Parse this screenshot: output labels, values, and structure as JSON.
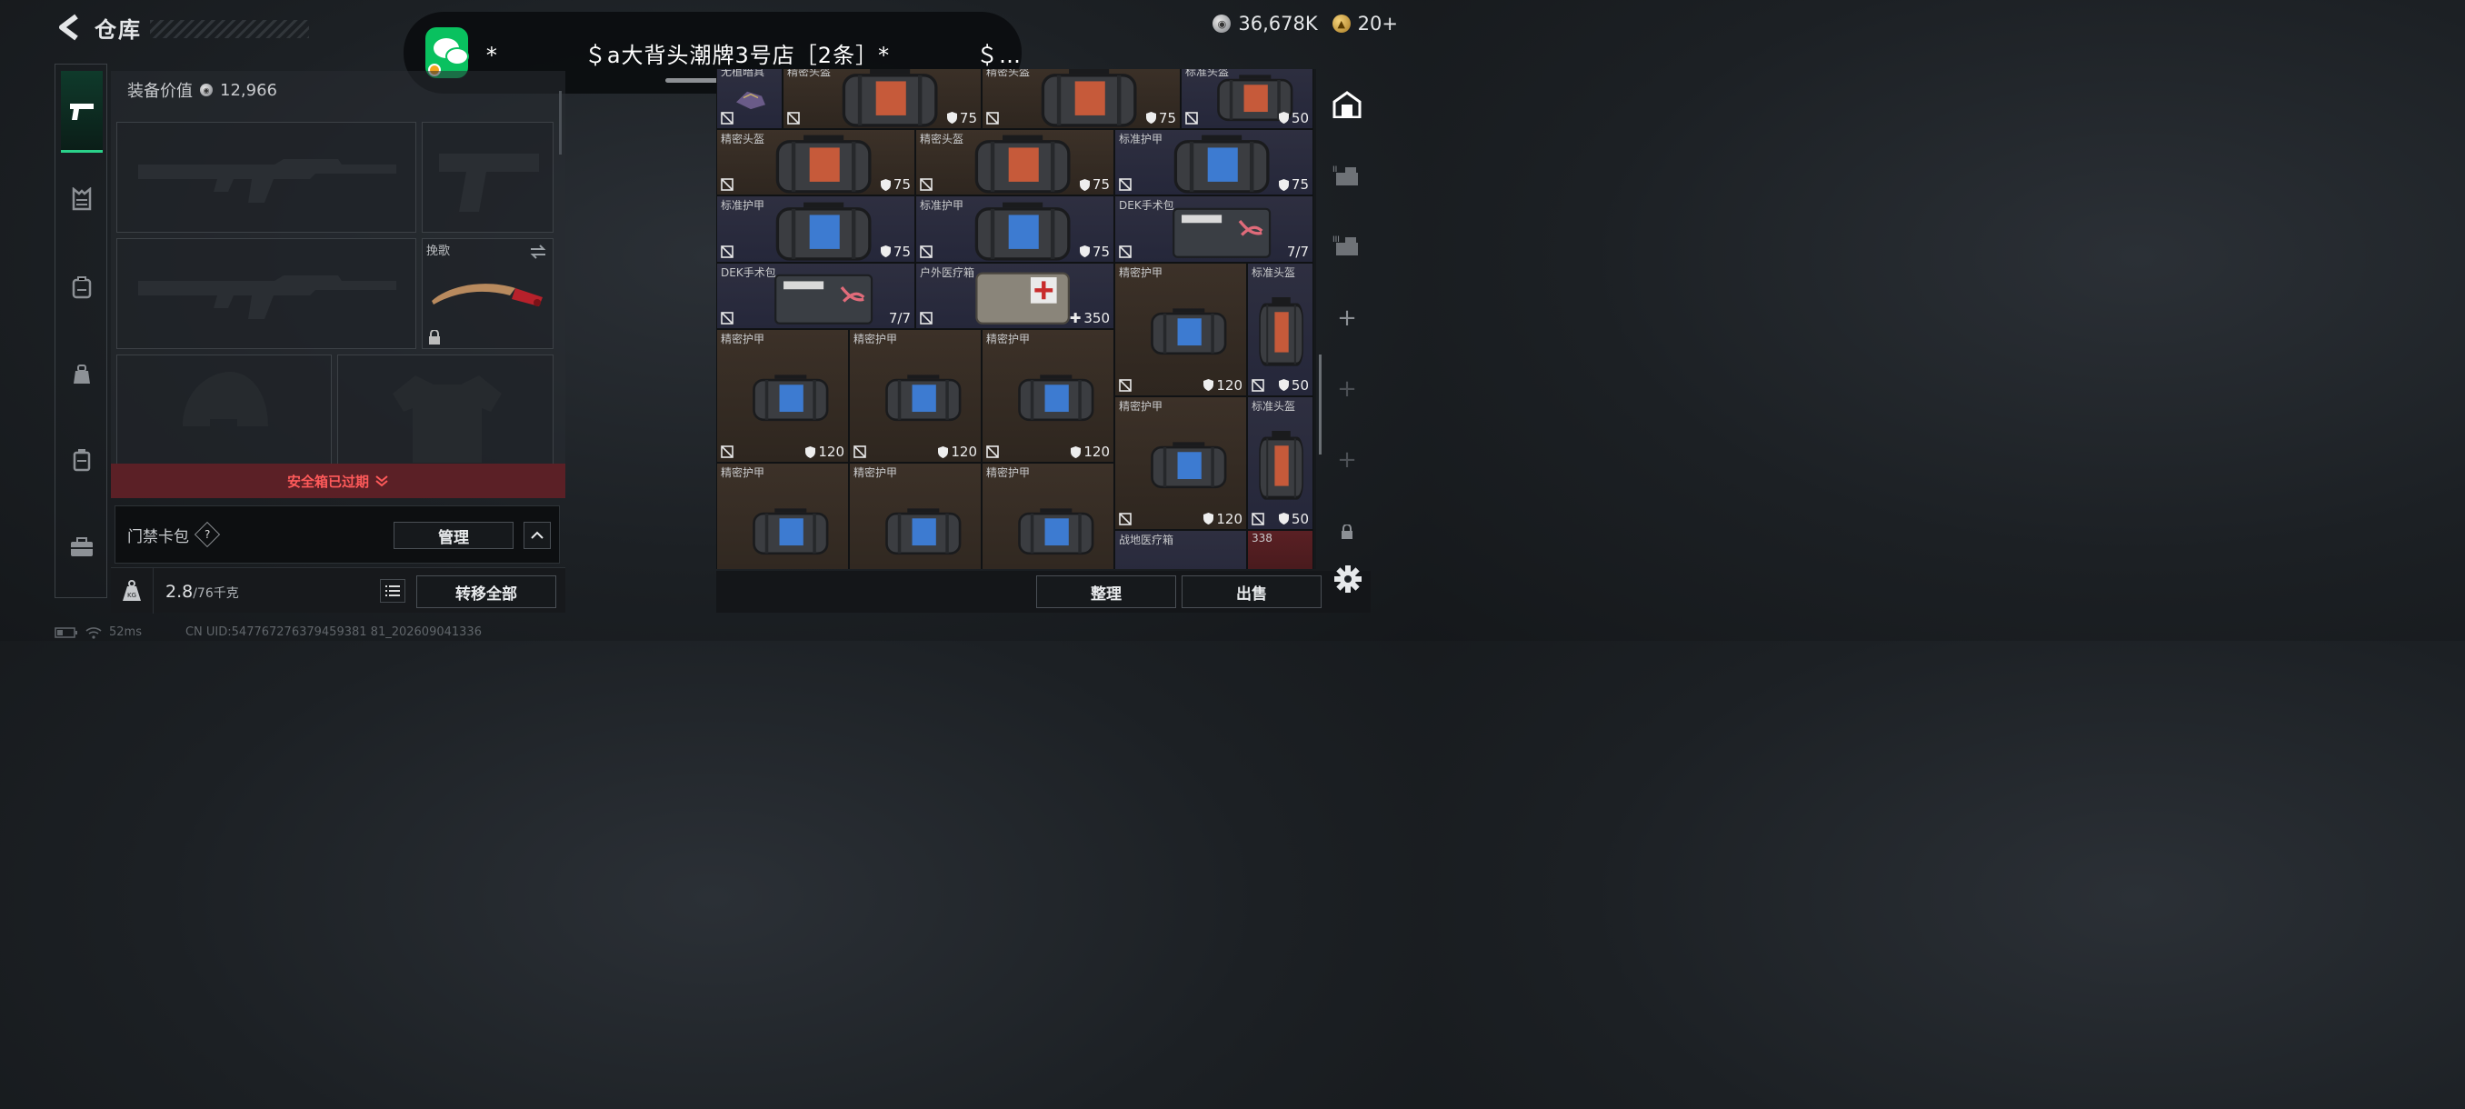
{
  "header": {
    "title": "仓库",
    "currency_silver": "36,678K",
    "currency_gold": "20+"
  },
  "notification": {
    "text": "*           ＄a大背头潮牌3号店［2条］*           ＄…"
  },
  "equipment": {
    "value_label": "装备价值",
    "value": "12,966",
    "melee_label": "挽歌"
  },
  "safe_box": {
    "status": "安全箱已过期"
  },
  "card_pack": {
    "label": "门禁卡包",
    "help": "?",
    "manage_label": "管理"
  },
  "weight": {
    "current": "2.8",
    "max": "/76千克"
  },
  "transfer_all_label": "转移全部",
  "status": {
    "ping": "52ms",
    "uid": "CN UID:547767276379459381 81_202609041336"
  },
  "warehouse": {
    "sort_label": "整理",
    "sell_label": "出售",
    "items": [
      {
        "name": "无植暗具",
        "stat": "",
        "bg": "blue"
      },
      {
        "name": "精密头盔",
        "stat": "75",
        "bg": "brown"
      },
      {
        "name": "精密头盔",
        "stat": "75",
        "bg": "brown"
      },
      {
        "name": "标准头盔",
        "stat": "50",
        "bg": "blue"
      },
      {
        "name": "精密头盔",
        "stat": "75",
        "bg": "brown"
      },
      {
        "name": "精密头盔",
        "stat": "75",
        "bg": "brown"
      },
      {
        "name": "标准护甲",
        "stat": "75",
        "bg": "blue"
      },
      {
        "name": "标准护甲",
        "stat": "75",
        "bg": "blue"
      },
      {
        "name": "标准护甲",
        "stat": "75",
        "bg": "blue"
      },
      {
        "name": "DEK手术包",
        "stat": "7/7",
        "bg": "blue"
      },
      {
        "name": "DEK手术包",
        "stat": "7/7",
        "bg": "blue"
      },
      {
        "name": "户外医疗箱",
        "stat": "350",
        "bg": "blue"
      },
      {
        "name": "精密护甲",
        "stat": "120",
        "bg": "brown"
      },
      {
        "name": "标准头盔",
        "stat": "50",
        "bg": "blue"
      },
      {
        "name": "精密护甲",
        "stat": "120",
        "bg": "brown"
      },
      {
        "name": "精密护甲",
        "stat": "120",
        "bg": "brown"
      },
      {
        "name": "精密护甲",
        "stat": "120",
        "bg": "brown"
      },
      {
        "name": "精密护甲",
        "stat": "120",
        "bg": "brown"
      },
      {
        "name": "标准头盔",
        "stat": "50",
        "bg": "blue"
      },
      {
        "name": "精密护甲",
        "stat": "",
        "bg": "brown"
      },
      {
        "name": "精密护甲",
        "stat": "",
        "bg": "brown"
      },
      {
        "name": "精密护甲",
        "stat": "",
        "bg": "brown"
      },
      {
        "name": "战地医疗箱",
        "stat": "",
        "bg": "blue"
      },
      {
        "name": "338",
        "stat": "",
        "bg": "red"
      }
    ]
  },
  "colors": {
    "accent_green": "#2ad18a",
    "alert_red": "#ff5a5a",
    "rare_brown": "#3c3128",
    "common_blue": "#2e2f40"
  }
}
